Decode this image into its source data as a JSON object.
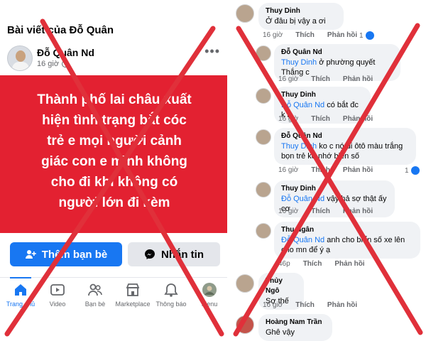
{
  "left": {
    "header_title": "Bài viết của Đỗ Quân",
    "author_name": "Đỗ Quân Nd",
    "post_time": "16 giờ",
    "more_icon": "more-dots-icon",
    "banner_lines": [
      "Thành phố lai châu xuất",
      "hiện tình trạng bắt cóc",
      "trẻ e mọi người cảnh",
      "giác con e mình không",
      "cho đi khi không có",
      "người lớn đi kèm"
    ],
    "banner_color": "#e32131",
    "add_friend_label": "Thêm bạn bè",
    "message_label": "Nhắn tin",
    "nav": [
      {
        "label": "Trang chủ",
        "icon": "home-icon"
      },
      {
        "label": "Video",
        "icon": "video-icon"
      },
      {
        "label": "Bạn bè",
        "icon": "friends-icon"
      },
      {
        "label": "Marketplace",
        "icon": "marketplace-icon"
      },
      {
        "label": "Thông báo",
        "icon": "bell-icon"
      },
      {
        "label": "Menu",
        "icon": "menu-avatar-icon"
      }
    ]
  },
  "comments": [
    {
      "name": "Thuy Dinh",
      "mention": "",
      "text": "Ở đâu bị vậy a ơi",
      "time": "16 giờ",
      "like": "Thích",
      "reply": "Phản hồi",
      "likes": "1"
    },
    {
      "name": "Đỗ Quân Nd",
      "mention": "Thuy Dinh",
      "text": " ở phường quyết Thắng c",
      "time": "16 giờ",
      "like": "Thích",
      "reply": "Phản hồi",
      "likes": ""
    },
    {
      "name": "Thuy Dinh",
      "mention": "Đỗ Quân Nd",
      "text": " có bắt đc k ạ",
      "time": "16 giờ",
      "like": "Thích",
      "reply": "Phản hồi",
      "likes": ""
    },
    {
      "name": "Đỗ Quân Nd",
      "mention": "Thuy Dinh",
      "text": " ko c nó đi ôtô màu trắng bọn trẻ ko nhớ biển số",
      "time": "16 giờ",
      "like": "Thích",
      "reply": "Phản hồi",
      "likes": "1"
    },
    {
      "name": "Thuy Dinh",
      "mention": "Đỗ Quân Nd",
      "text": " vậy hả sợ thật ấy cơ",
      "time": "16 giờ",
      "like": "Thích",
      "reply": "Phản hồi",
      "likes": ""
    },
    {
      "name": "Thu Ngân",
      "mention": "Đỗ Quân Nd",
      "text": " anh cho biển số xe lên cho mn để ý ạ",
      "time": "46p",
      "like": "Thích",
      "reply": "Phản hồi",
      "likes": ""
    },
    {
      "name": "Thủy Ngô",
      "mention": "",
      "text": "Sợ thế",
      "time": "16 giờ",
      "like": "Thích",
      "reply": "Phản hồi",
      "likes": ""
    },
    {
      "name": "Hoàng Nam Trần",
      "mention": "",
      "text": "Ghê vậy",
      "time": "",
      "like": "",
      "reply": "",
      "likes": ""
    }
  ],
  "overlay_color": "#e0303a"
}
